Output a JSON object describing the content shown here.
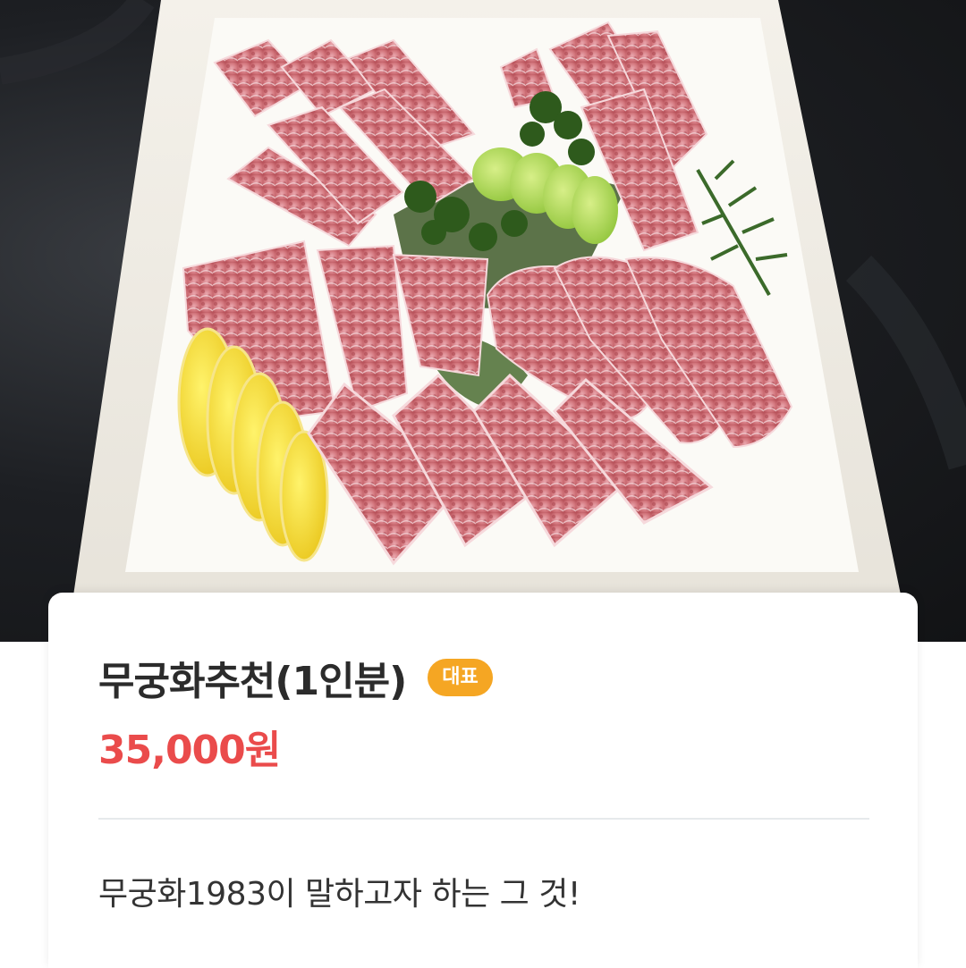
{
  "menu": {
    "title": "무궁화추천(1인분)",
    "badge": "대표",
    "price": "35,000원",
    "description": "무궁화1983이 말하고자 하는 그 것!"
  },
  "photo": {
    "subject": "marbled beef platter with lemon, lime and herbs"
  },
  "colors": {
    "badge": "#f5a623",
    "price": "#ea4b4b",
    "title": "#2b2b2b",
    "divider": "#e6eaec"
  }
}
